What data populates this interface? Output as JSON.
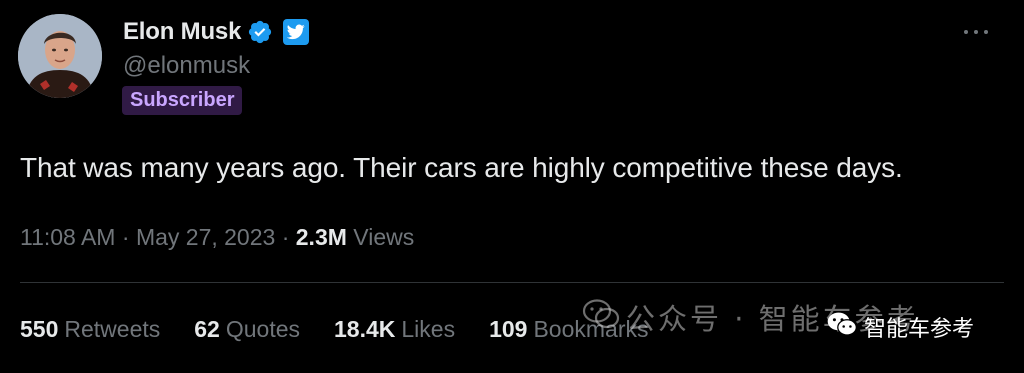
{
  "tweet": {
    "display_name": "Elon Musk",
    "handle": "@elonmusk",
    "badge": "Subscriber",
    "text": "That was many years ago. Their cars are highly competitive these days.",
    "time": "11:08 AM",
    "date": "May 27, 2023",
    "separator": "·",
    "views_count": "2.3M",
    "views_label": "Views"
  },
  "stats": [
    {
      "num": "550",
      "label": "Retweets"
    },
    {
      "num": "62",
      "label": "Quotes"
    },
    {
      "num": "18.4K",
      "label": "Likes"
    },
    {
      "num": "109",
      "label": "Bookmarks"
    }
  ],
  "watermark": {
    "large": "公众号 · 智能车参考",
    "small": "智能车参考"
  },
  "icons": {
    "verified": "verified-check-icon",
    "twitter": "twitter-bird-icon",
    "more": "more-options-icon",
    "wechat": "wechat-icon"
  },
  "colors": {
    "background": "#000000",
    "text": "#e7e9ea",
    "secondary": "#71767b",
    "verified": "#1d9bf0",
    "badge_bg": "#301a45",
    "badge_fg": "#c9a6ff",
    "divider": "#2f3336"
  }
}
